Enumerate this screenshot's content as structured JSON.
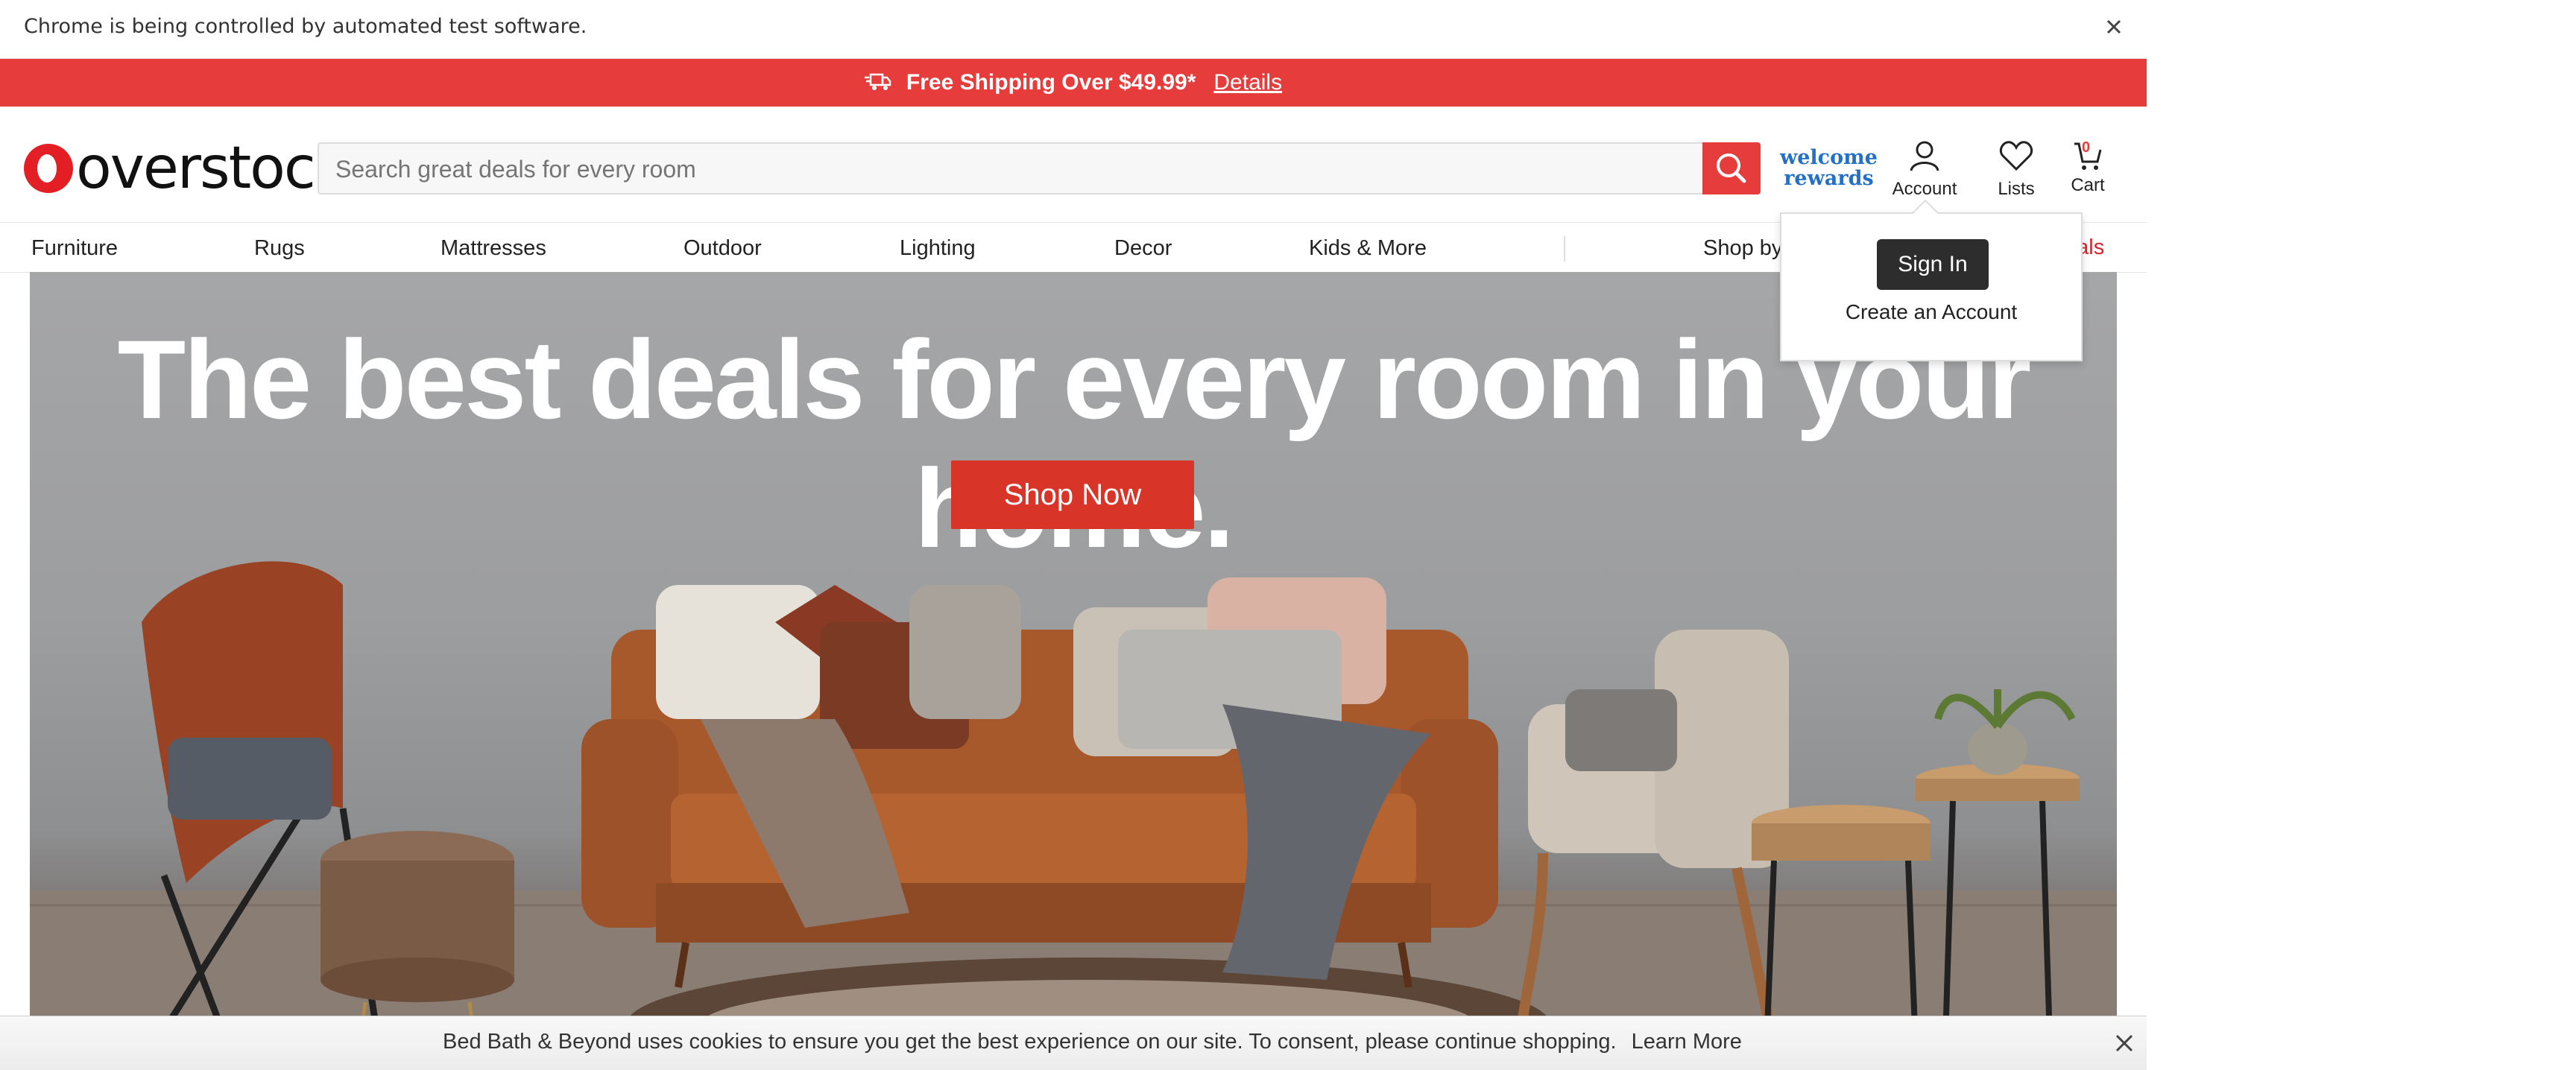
{
  "infobar": {
    "message": "Chrome is being controlled by automated test software."
  },
  "promo": {
    "text": "Free Shipping Over $49.99*",
    "details": "Details"
  },
  "header": {
    "logo": "overstock",
    "search": {
      "placeholder": "Search great deals for every room"
    },
    "welcome_rewards": [
      "welcome",
      "rewards"
    ],
    "account": "Account",
    "lists": "Lists",
    "cart": "Cart",
    "cart_count": "0"
  },
  "nav": {
    "items": [
      "Furniture",
      "Rugs",
      "Mattresses",
      "Outdoor",
      "Lighting",
      "Decor",
      "Kids & More"
    ],
    "shop_by": "Shop by",
    "deals_fragment": "eals"
  },
  "dropdown": {
    "sign_in": "Sign In",
    "create_account": "Create an Account"
  },
  "hero": {
    "headline": "The best deals for every room in your home.",
    "cta": "Shop Now"
  },
  "cookie": {
    "text": "Bed Bath & Beyond uses cookies to ensure you get the best experience on our site. To consent, please continue shopping.",
    "learn_more": "Learn More"
  },
  "colors": {
    "brand_red": "#e73c3c",
    "rewards_blue": "#2570c7",
    "dark_button": "#2d2d2d"
  }
}
